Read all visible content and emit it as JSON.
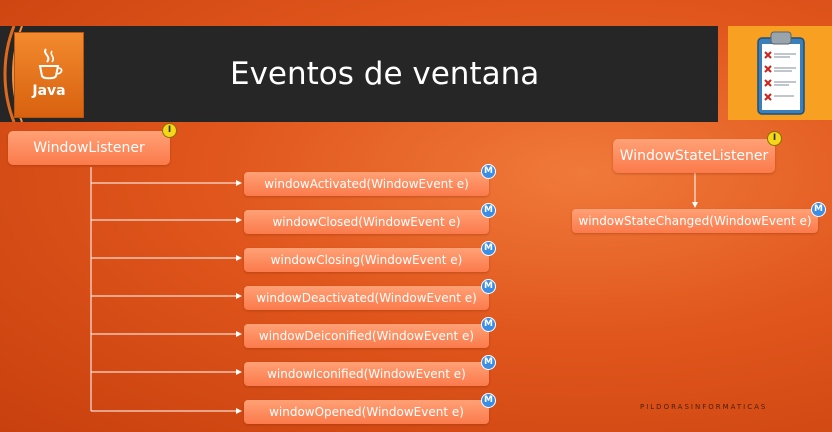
{
  "slide": {
    "title": "Eventos de ventana",
    "logo_text": "Java",
    "footer": "PILDORASINFORMATICAS"
  },
  "diagram": {
    "window_listener": {
      "label": "WindowListener",
      "badge": "I"
    },
    "methods": [
      {
        "label": "windowActivated(WindowEvent e)",
        "badge": "M"
      },
      {
        "label": "windowClosed(WindowEvent e)",
        "badge": "M"
      },
      {
        "label": "windowClosing(WindowEvent e)",
        "badge": "M"
      },
      {
        "label": "windowDeactivated(WindowEvent e)",
        "badge": "M"
      },
      {
        "label": "windowDeiconified(WindowEvent e)",
        "badge": "M"
      },
      {
        "label": "windowIconified(WindowEvent e)",
        "badge": "M"
      },
      {
        "label": "windowOpened(WindowEvent e)",
        "badge": "M"
      }
    ],
    "window_state_listener": {
      "label": "WindowStateListener",
      "badge": "I"
    },
    "state_method": {
      "label": "windowStateChanged(WindowEvent e)",
      "badge": "M"
    }
  },
  "colors": {
    "background": "#e0561c",
    "title_bar": "#262626",
    "box": "#fb7a4b",
    "badge_method": "#3a8ee6",
    "badge_interface": "#f4d61a"
  },
  "icons": {
    "logo": "java-cup-icon",
    "clipboard": "checklist-clipboard-icon"
  }
}
